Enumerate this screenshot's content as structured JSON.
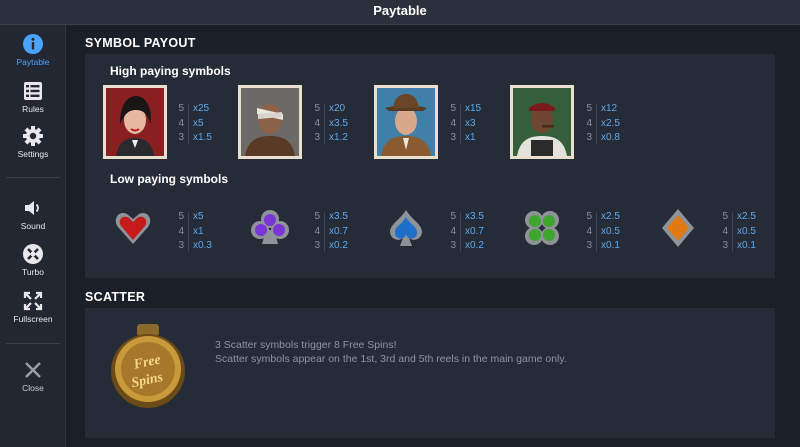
{
  "window": {
    "title": "Paytable"
  },
  "sidebar": {
    "items": [
      {
        "label": "Paytable",
        "icon": "info-icon",
        "active": true
      },
      {
        "label": "Rules",
        "icon": "list-icon"
      },
      {
        "label": "Settings",
        "icon": "gear-icon"
      },
      {
        "label": "Sound",
        "icon": "speaker-icon"
      },
      {
        "label": "Turbo",
        "icon": "turbo-icon"
      },
      {
        "label": "Fullscreen",
        "icon": "fullscreen-icon"
      },
      {
        "label": "Close",
        "icon": "close-icon"
      }
    ]
  },
  "symbol_payout": {
    "title": "SYMBOL PAYOUT",
    "high_title": "High paying symbols",
    "low_title": "Low paying symbols",
    "high": [
      {
        "name": "woman-portrait",
        "counts": [
          "5",
          "4",
          "3"
        ],
        "pays": [
          "x25",
          "x5",
          "x1.5"
        ]
      },
      {
        "name": "bandaged-man-portrait",
        "counts": [
          "5",
          "4",
          "3"
        ],
        "pays": [
          "x20",
          "x3.5",
          "x1.2"
        ]
      },
      {
        "name": "hat-man-portrait",
        "counts": [
          "5",
          "4",
          "3"
        ],
        "pays": [
          "x15",
          "x3",
          "x1"
        ]
      },
      {
        "name": "cigar-man-portrait",
        "counts": [
          "5",
          "4",
          "3"
        ],
        "pays": [
          "x12",
          "x2.5",
          "x0.8"
        ]
      }
    ],
    "low": [
      {
        "name": "heart-symbol",
        "counts": [
          "5",
          "4",
          "3"
        ],
        "pays": [
          "x5",
          "x1",
          "x0.3"
        ]
      },
      {
        "name": "club-symbol",
        "counts": [
          "5",
          "4",
          "3"
        ],
        "pays": [
          "x3.5",
          "x0.7",
          "x0.2"
        ]
      },
      {
        "name": "spade-symbol",
        "counts": [
          "5",
          "4",
          "3"
        ],
        "pays": [
          "x3.5",
          "x0.7",
          "x0.2"
        ]
      },
      {
        "name": "clover-symbol",
        "counts": [
          "5",
          "4",
          "3"
        ],
        "pays": [
          "x2.5",
          "x0.5",
          "x0.1"
        ]
      },
      {
        "name": "diamond-symbol",
        "counts": [
          "5",
          "4",
          "3"
        ],
        "pays": [
          "x2.5",
          "x0.5",
          "x0.1"
        ]
      }
    ]
  },
  "scatter": {
    "title": "SCATTER",
    "badge_text": "Free Spins",
    "line1": "3 Scatter symbols trigger 8 Free Spins!",
    "line2": "Scatter symbols appear on the 1st, 3rd and 5th reels in the main game only."
  }
}
